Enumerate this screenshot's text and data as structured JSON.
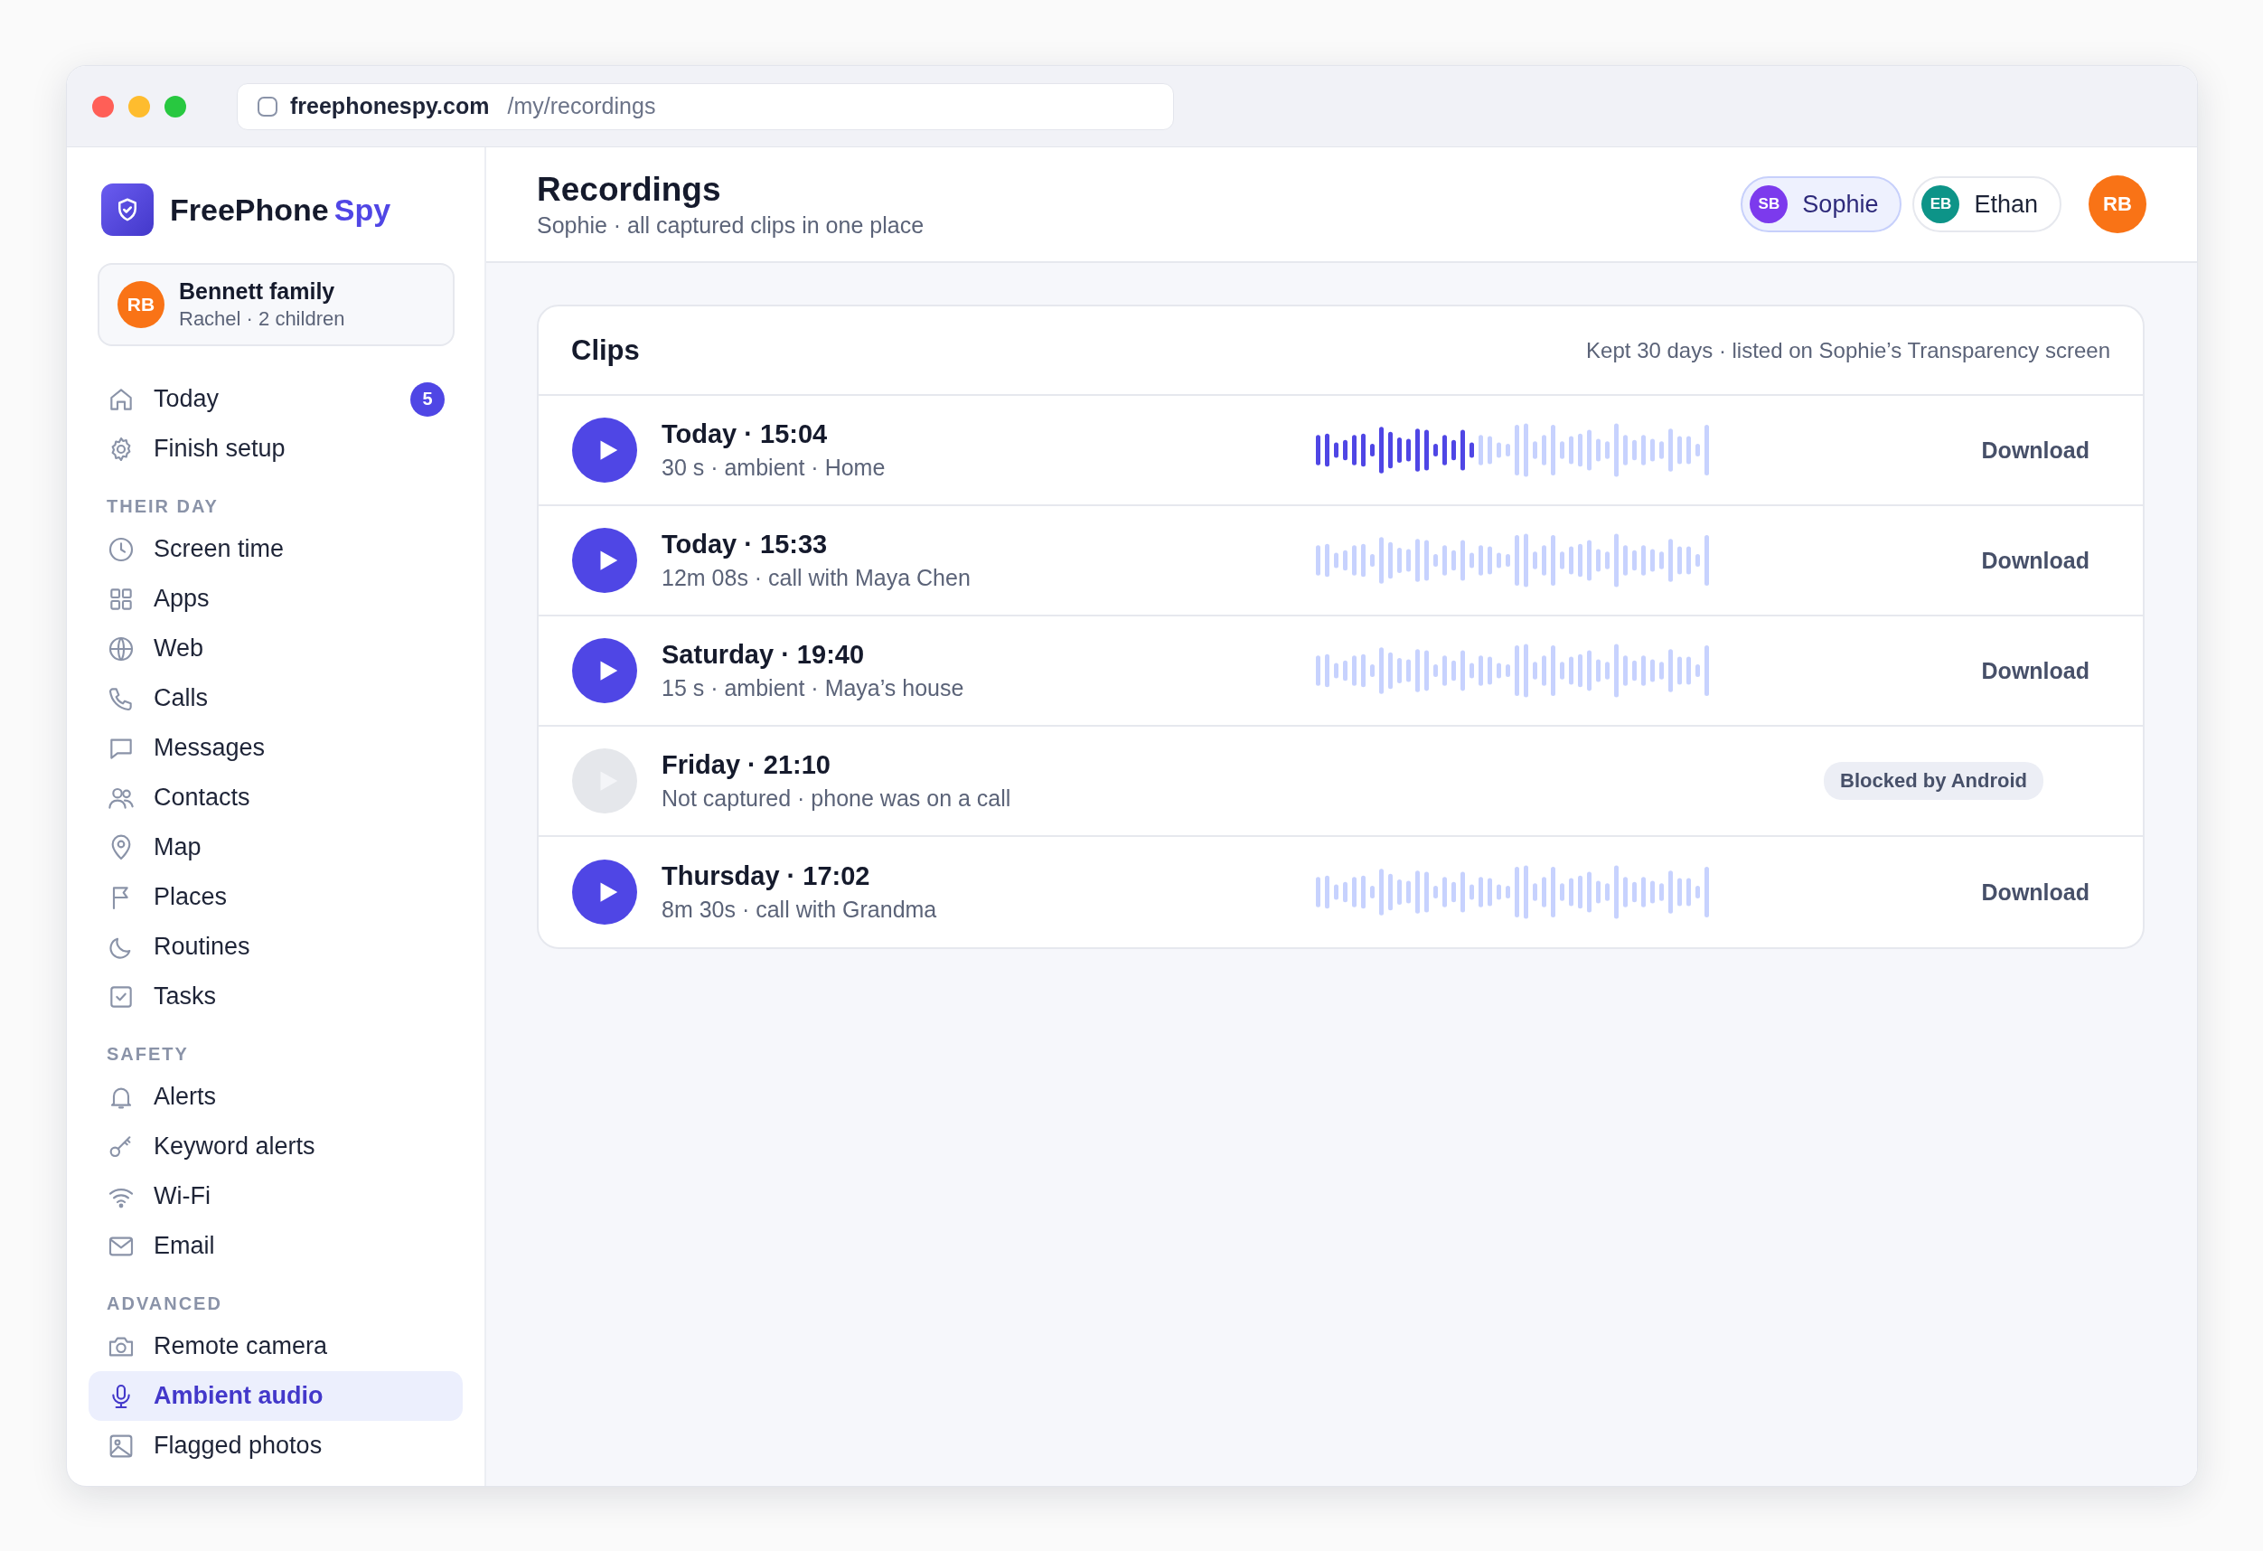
{
  "browser": {
    "domain": "freephonespy.com",
    "path": "/my/recordings"
  },
  "brand": {
    "name": "FreePhone",
    "accent": "Spy"
  },
  "account": {
    "initials": "RB",
    "name": "Bennett family",
    "detail": "Rachel · 2 children"
  },
  "sidebar": {
    "sections": [
      {
        "items": [
          {
            "label": "Today",
            "badge": "5",
            "selected": false
          },
          {
            "label": "Finish setup",
            "selected": false
          }
        ]
      },
      {
        "heading": "THEIR DAY",
        "items": [
          {
            "label": "Screen time",
            "selected": false
          },
          {
            "label": "Apps",
            "selected": false
          },
          {
            "label": "Web",
            "selected": false
          },
          {
            "label": "Calls",
            "selected": false
          },
          {
            "label": "Messages",
            "selected": false
          },
          {
            "label": "Contacts",
            "selected": false
          },
          {
            "label": "Map",
            "selected": false
          },
          {
            "label": "Places",
            "selected": false
          },
          {
            "label": "Routines",
            "selected": false
          },
          {
            "label": "Tasks",
            "selected": false
          }
        ]
      },
      {
        "heading": "SAFETY",
        "items": [
          {
            "label": "Alerts",
            "selected": false
          },
          {
            "label": "Keyword alerts",
            "selected": false
          },
          {
            "label": "Wi-Fi",
            "selected": false
          },
          {
            "label": "Email",
            "selected": false
          }
        ]
      },
      {
        "heading": "ADVANCED",
        "items": [
          {
            "label": "Remote camera",
            "selected": false
          },
          {
            "label": "Ambient audio",
            "selected": true
          },
          {
            "label": "Flagged photos",
            "selected": false
          }
        ]
      }
    ]
  },
  "header": {
    "title": "Recordings",
    "subtitle": "Sophie · all captured clips in one place",
    "children": [
      {
        "initials": "SB",
        "name": "Sophie",
        "color": "#7c3aed",
        "selected": true
      },
      {
        "initials": "EB",
        "name": "Ethan",
        "color": "#0d9488",
        "selected": false
      }
    ],
    "user_initials": "RB"
  },
  "clips": {
    "title": "Clips",
    "note": "Kept 30 days · listed on Sophie’s Transparency screen",
    "rows": [
      {
        "kind": "recording",
        "title": "Today · 15:04",
        "detail": "30 s · ambient · Home",
        "level": 0.41,
        "action": "Download"
      },
      {
        "kind": "recording",
        "title": "Today · 15:33",
        "detail": "12m 08s · call with Maya Chen",
        "action": "Download"
      },
      {
        "kind": "recording",
        "title": "Saturday · 19:40",
        "detail": "15 s · ambient · Maya’s house",
        "action": "Download"
      },
      {
        "kind": "blocked",
        "title": "Friday · 21:10",
        "detail": "Not captured · phone was on a call",
        "status": "Blocked by Android"
      },
      {
        "kind": "recording",
        "title": "Thursday · 17:02",
        "detail": "8m 30s · call with Grandma",
        "action": "Download"
      }
    ]
  }
}
